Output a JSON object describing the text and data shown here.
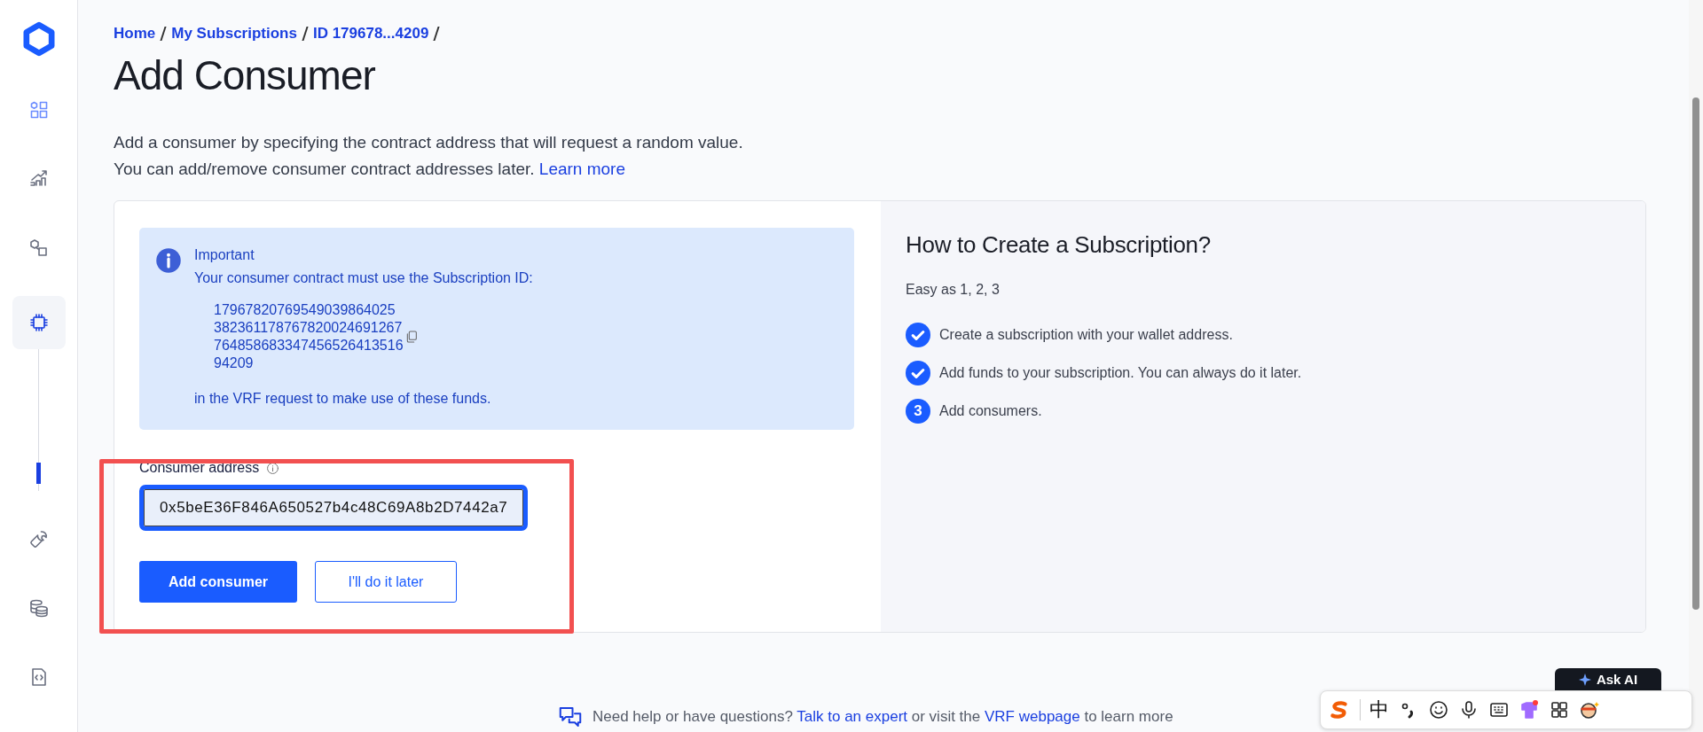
{
  "sidebar": {
    "items": [
      {
        "kind": "grid",
        "selected": false
      },
      {
        "kind": "chart",
        "selected": false
      },
      {
        "kind": "shapes",
        "selected": false
      },
      {
        "kind": "chip",
        "selected": true
      },
      {
        "kind": "wrench",
        "selected": false
      },
      {
        "kind": "coins",
        "selected": false
      },
      {
        "kind": "code",
        "selected": false
      }
    ]
  },
  "breadcrumb": [
    "Home",
    "My Subscriptions",
    "ID 179678...4209"
  ],
  "title": "Add Consumer",
  "description": {
    "lines": [
      "Add a consumer by specifying the contract address that will request a random value.",
      "You can add/remove consumer contract addresses later."
    ],
    "link": "Learn more"
  },
  "notice": {
    "title": "Important",
    "text": "Your consumer contract must use the Subscription ID:",
    "id_lines": [
      "17967820769549039864025",
      "382361178767820024691267",
      "764858683347456526413516",
      "94209"
    ],
    "footer": "in the VRF request to make use of these funds."
  },
  "form": {
    "label": "Consumer address",
    "input": {
      "value": "0x5beE36F846A650527b4c48C69A8b2D7442a7"
    },
    "buttons": [
      {
        "label": "Add consumer",
        "kind": "primary"
      },
      {
        "label": "I'll do it later",
        "kind": "secondary"
      }
    ]
  },
  "howto": {
    "title": "How to Create a Subscription?",
    "subtitle": "Easy as 1, 2, 3",
    "steps": [
      {
        "text": "Create a subscription with your wallet address.",
        "done": true
      },
      {
        "text": "Add funds to your subscription. You can always do it later.",
        "done": true
      },
      {
        "text": "Add consumers.",
        "done": false,
        "number": "3"
      }
    ]
  },
  "help": {
    "text_1": "Need help or have questions?",
    "link_1": "Talk to an expert",
    "text_2": "or visit the",
    "link_2": "VRF webpage",
    "text_3": "to learn more"
  },
  "ask_ai": {
    "label": "Ask AI"
  },
  "ime_toolbar": {
    "mode": "中"
  }
}
